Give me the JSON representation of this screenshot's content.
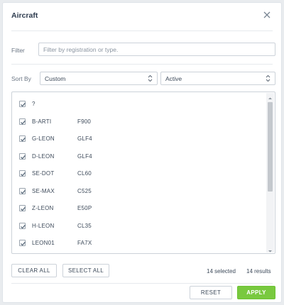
{
  "dialog": {
    "title": "Aircraft",
    "close_icon": "close-icon"
  },
  "filter": {
    "label": "Filter",
    "placeholder": "Filter by registration or type."
  },
  "sort": {
    "label": "Sort By",
    "value": "Custom",
    "status_value": "Active"
  },
  "aircraft": [
    {
      "reg": "?",
      "type": "",
      "checked": true
    },
    {
      "reg": "B-ARTI",
      "type": "F900",
      "checked": true
    },
    {
      "reg": "G-LEON",
      "type": "GLF4",
      "checked": true
    },
    {
      "reg": "D-LEON",
      "type": "GLF4",
      "checked": true
    },
    {
      "reg": "SE-DOT",
      "type": "CL60",
      "checked": true
    },
    {
      "reg": "SE-MAX",
      "type": "C525",
      "checked": true
    },
    {
      "reg": "Z-LEON",
      "type": "E50P",
      "checked": true
    },
    {
      "reg": "H-LEON",
      "type": "CL35",
      "checked": true
    },
    {
      "reg": "LEON01",
      "type": "FA7X",
      "checked": true
    }
  ],
  "actions": {
    "clear_all": "CLEAR ALL",
    "select_all": "SELECT ALL",
    "selected_count": "14 selected",
    "results_count": "14 results"
  },
  "footer": {
    "reset": "RESET",
    "apply": "APPLY"
  },
  "colors": {
    "apply_bg": "#79c93f",
    "title_text": "#2d3b4e",
    "check_mark": "#5b6b7c"
  }
}
